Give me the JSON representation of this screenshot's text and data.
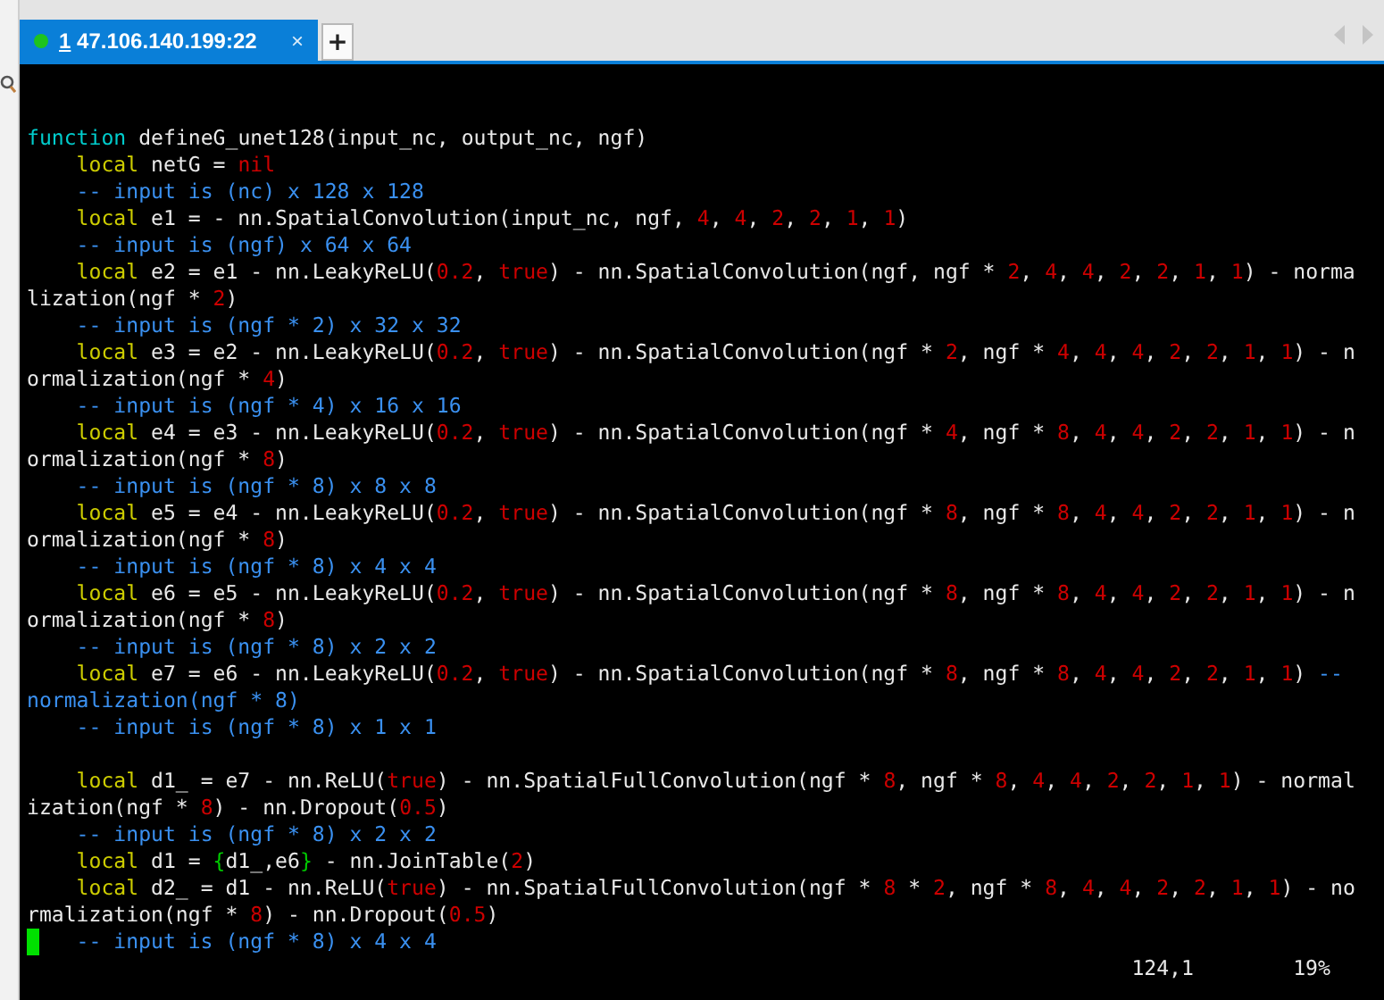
{
  "tabs": [
    {
      "number": "1",
      "label": "47.106.140.199:22",
      "selected": true,
      "close": "×"
    }
  ],
  "new_tab": "+",
  "terminal": {
    "lines": [
      {
        "kind": "blank"
      },
      {
        "kind": "blank"
      },
      {
        "kind": "code",
        "segments": [
          {
            "kind": "fn",
            "text": "function"
          },
          {
            "kind": "plain",
            "text": " defineG_unet128(input_nc, output_nc, ngf)"
          }
        ]
      },
      {
        "kind": "indented",
        "segments": [
          {
            "kind": "kw",
            "text": "local"
          },
          {
            "kind": "plain",
            "text": " netG = "
          },
          {
            "kind": "num",
            "text": "nil"
          }
        ]
      },
      {
        "kind": "code",
        "segments": [
          {
            "kind": "comment",
            "text": "    -- input is (nc) x 128 x 128"
          }
        ]
      },
      {
        "kind": "indented",
        "segments": [
          {
            "kind": "kw",
            "text": "local"
          },
          {
            "kind": "plain",
            "text": " e1 = - nn.SpatialConvolution(input_nc, ngf, "
          },
          {
            "kind": "num",
            "text": "4"
          },
          {
            "kind": "plain",
            "text": ", "
          },
          {
            "kind": "num",
            "text": "4"
          },
          {
            "kind": "plain",
            "text": ", "
          },
          {
            "kind": "num",
            "text": "2"
          },
          {
            "kind": "plain",
            "text": ", "
          },
          {
            "kind": "num",
            "text": "2"
          },
          {
            "kind": "plain",
            "text": ", "
          },
          {
            "kind": "num",
            "text": "1"
          },
          {
            "kind": "plain",
            "text": ", "
          },
          {
            "kind": "num",
            "text": "1"
          },
          {
            "kind": "plain",
            "text": ")"
          }
        ]
      },
      {
        "kind": "code",
        "segments": [
          {
            "kind": "comment",
            "text": "    -- input is (ngf) x 64 x 64"
          }
        ]
      },
      {
        "kind": "indented",
        "segments": [
          {
            "kind": "kw",
            "text": "local"
          },
          {
            "kind": "plain",
            "text": " e2 = e1 - nn.LeakyReLU("
          },
          {
            "kind": "num",
            "text": "0.2"
          },
          {
            "kind": "plain",
            "text": ", "
          },
          {
            "kind": "num",
            "text": "true"
          },
          {
            "kind": "plain",
            "text": ") - nn.SpatialConvolution(ngf, ngf * "
          },
          {
            "kind": "num",
            "text": "2"
          },
          {
            "kind": "plain",
            "text": ", "
          },
          {
            "kind": "num",
            "text": "4"
          },
          {
            "kind": "plain",
            "text": ", "
          },
          {
            "kind": "num",
            "text": "4"
          },
          {
            "kind": "plain",
            "text": ", "
          },
          {
            "kind": "num",
            "text": "2"
          },
          {
            "kind": "plain",
            "text": ", "
          },
          {
            "kind": "num",
            "text": "2"
          },
          {
            "kind": "plain",
            "text": ", "
          },
          {
            "kind": "num",
            "text": "1"
          },
          {
            "kind": "plain",
            "text": ", "
          },
          {
            "kind": "num",
            "text": "1"
          },
          {
            "kind": "plain",
            "text": ") - norma"
          }
        ]
      },
      {
        "kind": "code",
        "segments": [
          {
            "kind": "plain",
            "text": "lization(ngf * "
          },
          {
            "kind": "num",
            "text": "2"
          },
          {
            "kind": "plain",
            "text": ")"
          }
        ]
      },
      {
        "kind": "code",
        "segments": [
          {
            "kind": "comment",
            "text": "    -- input is (ngf * 2) x 32 x 32"
          }
        ]
      },
      {
        "kind": "indented",
        "segments": [
          {
            "kind": "kw",
            "text": "local"
          },
          {
            "kind": "plain",
            "text": " e3 = e2 - nn.LeakyReLU("
          },
          {
            "kind": "num",
            "text": "0.2"
          },
          {
            "kind": "plain",
            "text": ", "
          },
          {
            "kind": "num",
            "text": "true"
          },
          {
            "kind": "plain",
            "text": ") - nn.SpatialConvolution(ngf * "
          },
          {
            "kind": "num",
            "text": "2"
          },
          {
            "kind": "plain",
            "text": ", ngf * "
          },
          {
            "kind": "num",
            "text": "4"
          },
          {
            "kind": "plain",
            "text": ", "
          },
          {
            "kind": "num",
            "text": "4"
          },
          {
            "kind": "plain",
            "text": ", "
          },
          {
            "kind": "num",
            "text": "4"
          },
          {
            "kind": "plain",
            "text": ", "
          },
          {
            "kind": "num",
            "text": "2"
          },
          {
            "kind": "plain",
            "text": ", "
          },
          {
            "kind": "num",
            "text": "2"
          },
          {
            "kind": "plain",
            "text": ", "
          },
          {
            "kind": "num",
            "text": "1"
          },
          {
            "kind": "plain",
            "text": ", "
          },
          {
            "kind": "num",
            "text": "1"
          },
          {
            "kind": "plain",
            "text": ") - n"
          }
        ]
      },
      {
        "kind": "code",
        "segments": [
          {
            "kind": "plain",
            "text": "ormalization(ngf * "
          },
          {
            "kind": "num",
            "text": "4"
          },
          {
            "kind": "plain",
            "text": ")"
          }
        ]
      },
      {
        "kind": "code",
        "segments": [
          {
            "kind": "comment",
            "text": "    -- input is (ngf * 4) x 16 x 16"
          }
        ]
      },
      {
        "kind": "indented",
        "segments": [
          {
            "kind": "kw",
            "text": "local"
          },
          {
            "kind": "plain",
            "text": " e4 = e3 - nn.LeakyReLU("
          },
          {
            "kind": "num",
            "text": "0.2"
          },
          {
            "kind": "plain",
            "text": ", "
          },
          {
            "kind": "num",
            "text": "true"
          },
          {
            "kind": "plain",
            "text": ") - nn.SpatialConvolution(ngf * "
          },
          {
            "kind": "num",
            "text": "4"
          },
          {
            "kind": "plain",
            "text": ", ngf * "
          },
          {
            "kind": "num",
            "text": "8"
          },
          {
            "kind": "plain",
            "text": ", "
          },
          {
            "kind": "num",
            "text": "4"
          },
          {
            "kind": "plain",
            "text": ", "
          },
          {
            "kind": "num",
            "text": "4"
          },
          {
            "kind": "plain",
            "text": ", "
          },
          {
            "kind": "num",
            "text": "2"
          },
          {
            "kind": "plain",
            "text": ", "
          },
          {
            "kind": "num",
            "text": "2"
          },
          {
            "kind": "plain",
            "text": ", "
          },
          {
            "kind": "num",
            "text": "1"
          },
          {
            "kind": "plain",
            "text": ", "
          },
          {
            "kind": "num",
            "text": "1"
          },
          {
            "kind": "plain",
            "text": ") - n"
          }
        ]
      },
      {
        "kind": "code",
        "segments": [
          {
            "kind": "plain",
            "text": "ormalization(ngf * "
          },
          {
            "kind": "num",
            "text": "8"
          },
          {
            "kind": "plain",
            "text": ")"
          }
        ]
      },
      {
        "kind": "code",
        "segments": [
          {
            "kind": "comment",
            "text": "    -- input is (ngf * 8) x 8 x 8"
          }
        ]
      },
      {
        "kind": "indented",
        "segments": [
          {
            "kind": "kw",
            "text": "local"
          },
          {
            "kind": "plain",
            "text": " e5 = e4 - nn.LeakyReLU("
          },
          {
            "kind": "num",
            "text": "0.2"
          },
          {
            "kind": "plain",
            "text": ", "
          },
          {
            "kind": "num",
            "text": "true"
          },
          {
            "kind": "plain",
            "text": ") - nn.SpatialConvolution(ngf * "
          },
          {
            "kind": "num",
            "text": "8"
          },
          {
            "kind": "plain",
            "text": ", ngf * "
          },
          {
            "kind": "num",
            "text": "8"
          },
          {
            "kind": "plain",
            "text": ", "
          },
          {
            "kind": "num",
            "text": "4"
          },
          {
            "kind": "plain",
            "text": ", "
          },
          {
            "kind": "num",
            "text": "4"
          },
          {
            "kind": "plain",
            "text": ", "
          },
          {
            "kind": "num",
            "text": "2"
          },
          {
            "kind": "plain",
            "text": ", "
          },
          {
            "kind": "num",
            "text": "2"
          },
          {
            "kind": "plain",
            "text": ", "
          },
          {
            "kind": "num",
            "text": "1"
          },
          {
            "kind": "plain",
            "text": ", "
          },
          {
            "kind": "num",
            "text": "1"
          },
          {
            "kind": "plain",
            "text": ") - n"
          }
        ]
      },
      {
        "kind": "code",
        "segments": [
          {
            "kind": "plain",
            "text": "ormalization(ngf * "
          },
          {
            "kind": "num",
            "text": "8"
          },
          {
            "kind": "plain",
            "text": ")"
          }
        ]
      },
      {
        "kind": "code",
        "segments": [
          {
            "kind": "comment",
            "text": "    -- input is (ngf * 8) x 4 x 4"
          }
        ]
      },
      {
        "kind": "indented",
        "segments": [
          {
            "kind": "kw",
            "text": "local"
          },
          {
            "kind": "plain",
            "text": " e6 = e5 - nn.LeakyReLU("
          },
          {
            "kind": "num",
            "text": "0.2"
          },
          {
            "kind": "plain",
            "text": ", "
          },
          {
            "kind": "num",
            "text": "true"
          },
          {
            "kind": "plain",
            "text": ") - nn.SpatialConvolution(ngf * "
          },
          {
            "kind": "num",
            "text": "8"
          },
          {
            "kind": "plain",
            "text": ", ngf * "
          },
          {
            "kind": "num",
            "text": "8"
          },
          {
            "kind": "plain",
            "text": ", "
          },
          {
            "kind": "num",
            "text": "4"
          },
          {
            "kind": "plain",
            "text": ", "
          },
          {
            "kind": "num",
            "text": "4"
          },
          {
            "kind": "plain",
            "text": ", "
          },
          {
            "kind": "num",
            "text": "2"
          },
          {
            "kind": "plain",
            "text": ", "
          },
          {
            "kind": "num",
            "text": "2"
          },
          {
            "kind": "plain",
            "text": ", "
          },
          {
            "kind": "num",
            "text": "1"
          },
          {
            "kind": "plain",
            "text": ", "
          },
          {
            "kind": "num",
            "text": "1"
          },
          {
            "kind": "plain",
            "text": ") - n"
          }
        ]
      },
      {
        "kind": "code",
        "segments": [
          {
            "kind": "plain",
            "text": "ormalization(ngf * "
          },
          {
            "kind": "num",
            "text": "8"
          },
          {
            "kind": "plain",
            "text": ")"
          }
        ]
      },
      {
        "kind": "code",
        "segments": [
          {
            "kind": "comment",
            "text": "    -- input is (ngf * 8) x 2 x 2"
          }
        ]
      },
      {
        "kind": "indented",
        "segments": [
          {
            "kind": "kw",
            "text": "local"
          },
          {
            "kind": "plain",
            "text": " e7 = e6 - nn.LeakyReLU("
          },
          {
            "kind": "num",
            "text": "0.2"
          },
          {
            "kind": "plain",
            "text": ", "
          },
          {
            "kind": "num",
            "text": "true"
          },
          {
            "kind": "plain",
            "text": ") - nn.SpatialConvolution(ngf * "
          },
          {
            "kind": "num",
            "text": "8"
          },
          {
            "kind": "plain",
            "text": ", ngf * "
          },
          {
            "kind": "num",
            "text": "8"
          },
          {
            "kind": "plain",
            "text": ", "
          },
          {
            "kind": "num",
            "text": "4"
          },
          {
            "kind": "plain",
            "text": ", "
          },
          {
            "kind": "num",
            "text": "4"
          },
          {
            "kind": "plain",
            "text": ", "
          },
          {
            "kind": "num",
            "text": "2"
          },
          {
            "kind": "plain",
            "text": ", "
          },
          {
            "kind": "num",
            "text": "2"
          },
          {
            "kind": "plain",
            "text": ", "
          },
          {
            "kind": "num",
            "text": "1"
          },
          {
            "kind": "plain",
            "text": ", "
          },
          {
            "kind": "num",
            "text": "1"
          },
          {
            "kind": "plain",
            "text": ") "
          },
          {
            "kind": "comment",
            "text": "--"
          }
        ]
      },
      {
        "kind": "code",
        "segments": [
          {
            "kind": "comment",
            "text": "normalization(ngf * 8)"
          }
        ]
      },
      {
        "kind": "code",
        "segments": [
          {
            "kind": "comment",
            "text": "    -- input is (ngf * 8) x 1 x 1"
          }
        ]
      },
      {
        "kind": "blank"
      },
      {
        "kind": "indented",
        "segments": [
          {
            "kind": "kw",
            "text": "local"
          },
          {
            "kind": "plain",
            "text": " d1_ = e7 - nn.ReLU("
          },
          {
            "kind": "num",
            "text": "true"
          },
          {
            "kind": "plain",
            "text": ") - nn.SpatialFullConvolution(ngf * "
          },
          {
            "kind": "num",
            "text": "8"
          },
          {
            "kind": "plain",
            "text": ", ngf * "
          },
          {
            "kind": "num",
            "text": "8"
          },
          {
            "kind": "plain",
            "text": ", "
          },
          {
            "kind": "num",
            "text": "4"
          },
          {
            "kind": "plain",
            "text": ", "
          },
          {
            "kind": "num",
            "text": "4"
          },
          {
            "kind": "plain",
            "text": ", "
          },
          {
            "kind": "num",
            "text": "2"
          },
          {
            "kind": "plain",
            "text": ", "
          },
          {
            "kind": "num",
            "text": "2"
          },
          {
            "kind": "plain",
            "text": ", "
          },
          {
            "kind": "num",
            "text": "1"
          },
          {
            "kind": "plain",
            "text": ", "
          },
          {
            "kind": "num",
            "text": "1"
          },
          {
            "kind": "plain",
            "text": ") - normal"
          }
        ]
      },
      {
        "kind": "code",
        "segments": [
          {
            "kind": "plain",
            "text": "ization(ngf * "
          },
          {
            "kind": "num",
            "text": "8"
          },
          {
            "kind": "plain",
            "text": ") - nn.Dropout("
          },
          {
            "kind": "num",
            "text": "0.5"
          },
          {
            "kind": "plain",
            "text": ")"
          }
        ]
      },
      {
        "kind": "code",
        "segments": [
          {
            "kind": "comment",
            "text": "    -- input is (ngf * 8) x 2 x 2"
          }
        ]
      },
      {
        "kind": "indented",
        "segments": [
          {
            "kind": "kw",
            "text": "local"
          },
          {
            "kind": "plain",
            "text": " d1 = "
          },
          {
            "kind": "brace",
            "text": "{"
          },
          {
            "kind": "plain",
            "text": "d1_,e6"
          },
          {
            "kind": "brace",
            "text": "}"
          },
          {
            "kind": "plain",
            "text": " - nn.JoinTable("
          },
          {
            "kind": "num",
            "text": "2"
          },
          {
            "kind": "plain",
            "text": ")"
          }
        ]
      },
      {
        "kind": "indented",
        "segments": [
          {
            "kind": "kw",
            "text": "local"
          },
          {
            "kind": "plain",
            "text": " d2_ = d1 - nn.ReLU("
          },
          {
            "kind": "num",
            "text": "true"
          },
          {
            "kind": "plain",
            "text": ") - nn.SpatialFullConvolution(ngf * "
          },
          {
            "kind": "num",
            "text": "8"
          },
          {
            "kind": "plain",
            "text": " * "
          },
          {
            "kind": "num",
            "text": "2"
          },
          {
            "kind": "plain",
            "text": ", ngf * "
          },
          {
            "kind": "num",
            "text": "8"
          },
          {
            "kind": "plain",
            "text": ", "
          },
          {
            "kind": "num",
            "text": "4"
          },
          {
            "kind": "plain",
            "text": ", "
          },
          {
            "kind": "num",
            "text": "4"
          },
          {
            "kind": "plain",
            "text": ", "
          },
          {
            "kind": "num",
            "text": "2"
          },
          {
            "kind": "plain",
            "text": ", "
          },
          {
            "kind": "num",
            "text": "2"
          },
          {
            "kind": "plain",
            "text": ", "
          },
          {
            "kind": "num",
            "text": "1"
          },
          {
            "kind": "plain",
            "text": ", "
          },
          {
            "kind": "num",
            "text": "1"
          },
          {
            "kind": "plain",
            "text": ") - no"
          }
        ]
      },
      {
        "kind": "code",
        "segments": [
          {
            "kind": "plain",
            "text": "rmalization(ngf * "
          },
          {
            "kind": "num",
            "text": "8"
          },
          {
            "kind": "plain",
            "text": ") - nn.Dropout("
          },
          {
            "kind": "num",
            "text": "0.5"
          },
          {
            "kind": "plain",
            "text": ")"
          }
        ]
      },
      {
        "kind": "cursor",
        "segments": [
          {
            "kind": "comment",
            "text": "   -- input is (ngf * 8) x 4 x 4"
          }
        ]
      }
    ],
    "ruler": "124,1",
    "percent": "19%"
  }
}
